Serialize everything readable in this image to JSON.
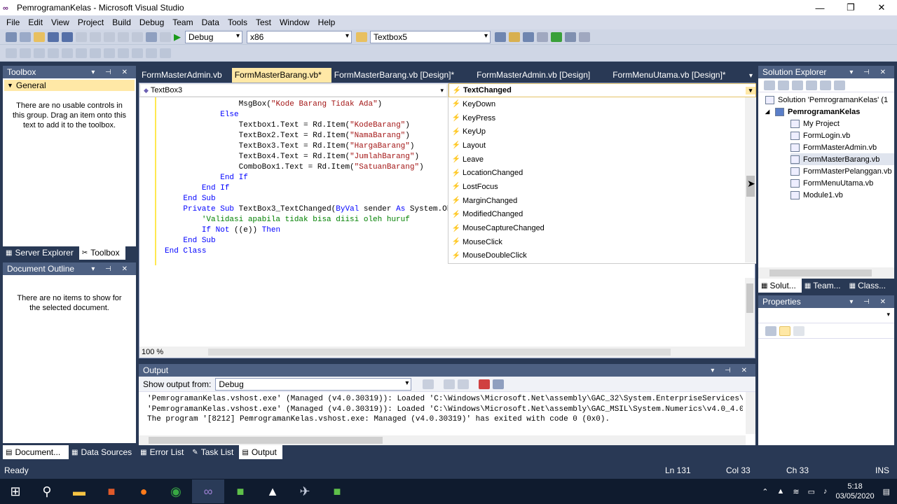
{
  "window": {
    "title": "PemrogramanKelas - Microsoft Visual Studio"
  },
  "menu": [
    "File",
    "Edit",
    "View",
    "Project",
    "Build",
    "Debug",
    "Team",
    "Data",
    "Tools",
    "Test",
    "Window",
    "Help"
  ],
  "toolbar": {
    "config": "Debug",
    "platform": "x86",
    "find": "Textbox5"
  },
  "toolbox": {
    "title": "Toolbox",
    "group": "General",
    "empty_msg": "There are no usable controls in this group. Drag an item onto this text to add it to the toolbox.",
    "tab_server": "Server Explorer",
    "tab_toolbox": "Toolbox"
  },
  "doc_outline": {
    "title": "Document Outline",
    "empty_msg": "There are no items to show for the selected document."
  },
  "tabs": [
    "FormMasterAdmin.vb",
    "FormMasterBarang.vb*",
    "FormMasterBarang.vb [Design]*",
    "FormMasterAdmin.vb [Design]",
    "FormMenuUtama.vb [Design]*"
  ],
  "editor": {
    "object_dropdown": "TextBox3",
    "event_dropdown": "TextChanged",
    "zoom": "100 %",
    "lines": [
      {
        "indent": "                ",
        "text": "MsgBox(\"Kode Barang Tidak Ada\")"
      },
      {
        "indent": "            ",
        "text": "Else"
      },
      {
        "indent": "                ",
        "text": "Textbox1.Text = Rd.Item(\"KodeBarang\")"
      },
      {
        "indent": "                ",
        "text": "TextBox2.Text = Rd.Item(\"NamaBarang\")"
      },
      {
        "indent": "                ",
        "text": "TextBox3.Text = Rd.Item(\"HargaBarang\")"
      },
      {
        "indent": "                ",
        "text": "TextBox4.Text = Rd.Item(\"JumlahBarang\")"
      },
      {
        "indent": "                ",
        "text": "ComboBox1.Text = Rd.Item(\"SatuanBarang\")"
      },
      {
        "indent": "            ",
        "text": "End If"
      },
      {
        "indent": "        ",
        "text": "End If"
      },
      {
        "indent": "    ",
        "text": "End Sub"
      },
      {
        "indent": "",
        "text": ""
      },
      {
        "indent": "    ",
        "text": "Private Sub TextBox3_TextChanged(ByVal sender As System.Ob"
      },
      {
        "indent": "        ",
        "text": "'Validasi apabila tidak bisa diisi oleh huruf"
      },
      {
        "indent": "        ",
        "text": "If Not ((e)) Then"
      },
      {
        "indent": "    ",
        "text": "End Sub"
      },
      {
        "indent": "",
        "text": "End Class"
      }
    ],
    "event_list": [
      "KeyDown",
      "KeyPress",
      "KeyUp",
      "Layout",
      "Leave",
      "LocationChanged",
      "LostFocus",
      "MarginChanged",
      "ModifiedChanged",
      "MouseCaptureChanged",
      "MouseClick",
      "MouseDoubleClick"
    ]
  },
  "solution": {
    "title": "Solution Explorer",
    "root": "Solution 'PemrogramanKelas' (1",
    "project": "PemrogramanKelas",
    "items": [
      "My Project",
      "FormLogin.vb",
      "FormMasterAdmin.vb",
      "FormMasterBarang.vb",
      "FormMasterPelanggan.vb",
      "FormMenuUtama.vb",
      "Module1.vb"
    ],
    "tabs": [
      "Solut...",
      "Team...",
      "Class..."
    ]
  },
  "properties": {
    "title": "Properties"
  },
  "output": {
    "title": "Output",
    "show_from_label": "Show output from:",
    "source": "Debug",
    "lines": [
      "'PemrogramanKelas.vshost.exe' (Managed (v4.0.30319)): Loaded 'C:\\Windows\\Microsoft.Net\\assembly\\GAC_32\\System.EnterpriseServices\\v",
      "'PemrogramanKelas.vshost.exe' (Managed (v4.0.30319)): Loaded 'C:\\Windows\\Microsoft.Net\\assembly\\GAC_MSIL\\System.Numerics\\v4.0_4.0.",
      "The program '[8212] PemrogramanKelas.vshost.exe: Managed (v4.0.30319)' has exited with code 0 (0x0)."
    ]
  },
  "bottom_tabs": [
    "Document...",
    "Data Sources",
    "Error List",
    "Task List",
    "Output"
  ],
  "status": {
    "left": "Ready",
    "ln": "Ln 131",
    "col": "Col 33",
    "ch": "Ch 33",
    "ins": "INS"
  },
  "taskbar": {
    "time": "5:18",
    "date": "03/05/2020"
  }
}
